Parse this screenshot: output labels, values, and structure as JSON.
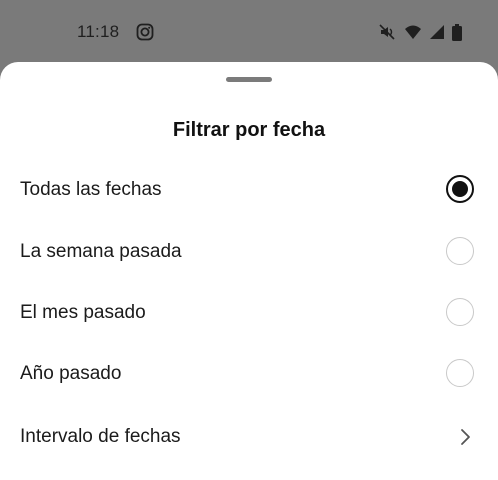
{
  "status_bar": {
    "time": "11:18",
    "icons": [
      "instagram-icon",
      "mute-icon",
      "wifi-icon",
      "signal-icon",
      "battery-icon"
    ]
  },
  "sheet": {
    "title": "Filtrar por fecha",
    "options": [
      {
        "label": "Todas las fechas",
        "selected": true
      },
      {
        "label": "La semana pasada",
        "selected": false
      },
      {
        "label": "El mes pasado",
        "selected": false
      },
      {
        "label": "Año pasado",
        "selected": false
      }
    ],
    "range_item": {
      "label": "Intervalo de fechas",
      "icon": "chevron-right-icon"
    }
  },
  "colors": {
    "scrim": "#7a7a7a",
    "sheet_bg": "#ffffff",
    "text": "#1b1b1b",
    "radio_border": "#c9c9c9",
    "radio_selected": "#111111"
  }
}
